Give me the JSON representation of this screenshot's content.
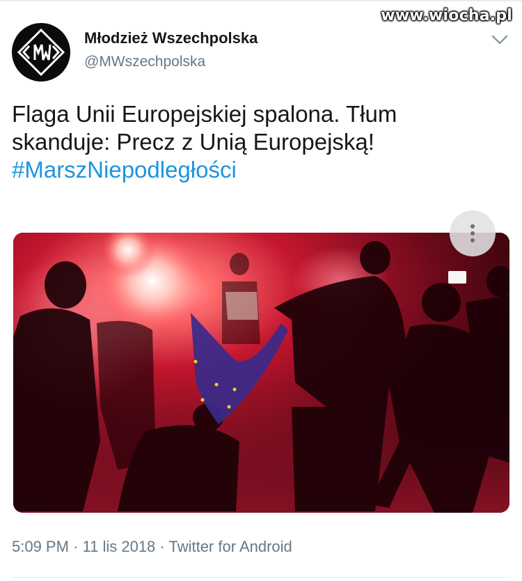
{
  "watermark": "www.wiocha.pl",
  "tweet": {
    "author": {
      "display_name": "Młodzież Wszechpolska",
      "handle": "@MWszechpolska",
      "avatar_text": "MW"
    },
    "text_lines": [
      "Flaga Unii Europejskiej spalona. Tłum",
      "skanduje: Precz z Unią Europejską!"
    ],
    "hashtag": "#MarszNiepodległości",
    "media": {
      "icon": "photo",
      "more_icon": "more-vertical-icon"
    },
    "meta": {
      "time": "5:09 PM",
      "date": "11 lis 2018",
      "source": "Twitter for Android"
    }
  },
  "colors": {
    "hashtag": "#1b95e0",
    "secondary_text": "#657786",
    "primary_text": "#14171a"
  }
}
